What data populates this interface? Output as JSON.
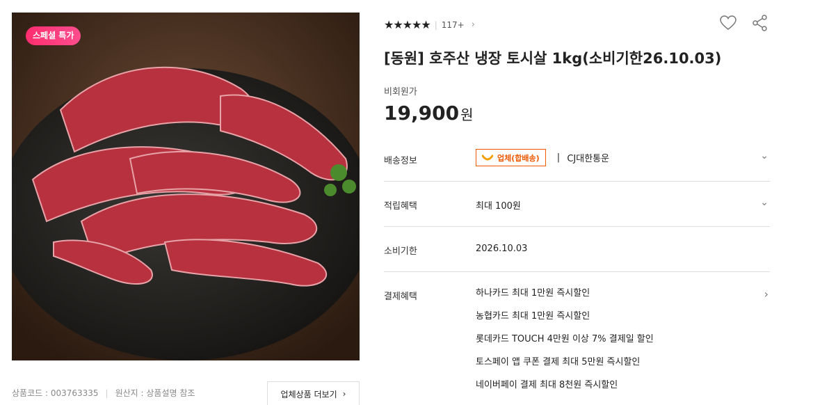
{
  "image": {
    "badge": "스페셜 특가"
  },
  "meta": {
    "product_code": "상품코드 : 003763335",
    "origin": "원산지 : 상품설명 참조"
  },
  "more_button": {
    "label": "업체상품 더보기"
  },
  "rating": {
    "stars": "★★★★★",
    "count": "117+"
  },
  "title": "[동원] 호주산 냉장 토시살 1kg(소비기한26.10.03)",
  "price": {
    "label": "비회원가",
    "amount": "19,900",
    "unit": "원"
  },
  "shipping": {
    "label": "배송정보",
    "badge": "업체(합배송)",
    "carrier": "CJ대한통운"
  },
  "points": {
    "label": "적립혜택",
    "value": "최대 100원"
  },
  "expiry": {
    "label": "소비기한",
    "value": "2026.10.03"
  },
  "payment": {
    "label": "결제혜택",
    "items": [
      "하나카드 최대 1만원 즉시할인",
      "농협카드 최대 1만원 즉시할인",
      "롯데카드 TOUCH 4만원 이상 7% 결제일 할인",
      "토스페이 앱 쿠폰 결제 최대 5만원 즉시할인",
      "네이버페이 결제 최대 8천원 즉시할인"
    ]
  },
  "colors": {
    "accent_orange": "#f05a00",
    "badge_pink": "#ff2d6f"
  }
}
